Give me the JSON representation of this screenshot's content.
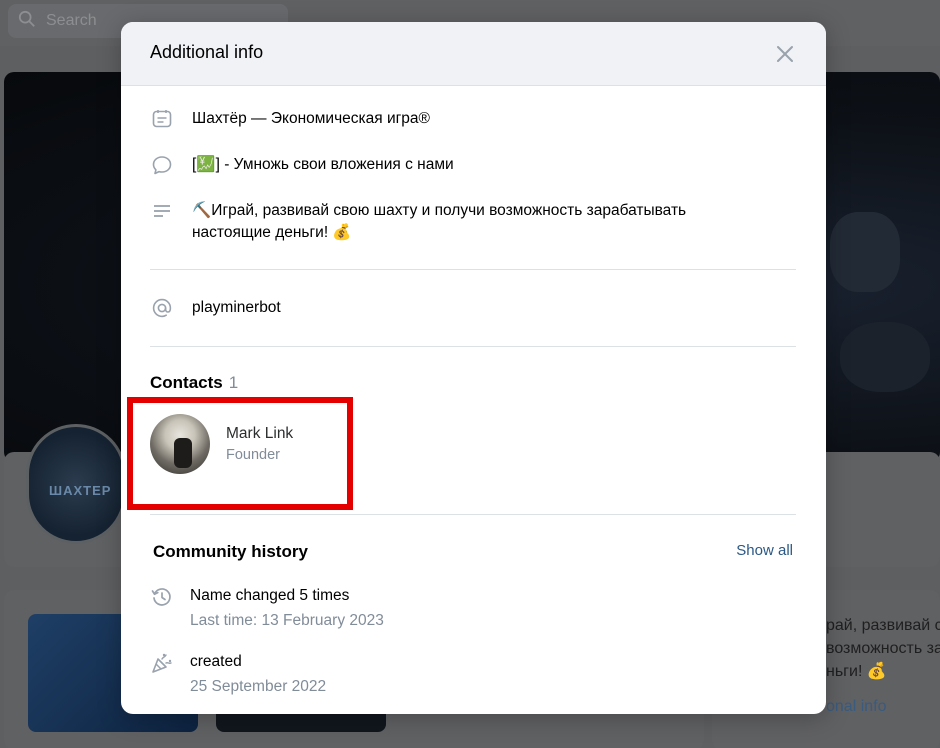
{
  "background": {
    "search_placeholder": "Search",
    "right_text": "рай, развивай с\nвозможность зараба\nньги! 💰",
    "right_link": "onal info",
    "avatar_text": "ШАХТЕР"
  },
  "modal": {
    "title": "Additional info",
    "info": [
      {
        "icon": "note-icon",
        "text": "Шахтёр — Экономическая игра®"
      },
      {
        "icon": "comment-icon",
        "text": "[💹] - Умножь свои вложения с нами"
      },
      {
        "icon": "text-lines-icon",
        "text": "⛏️Играй, развивай свою шахту и получи возможность зарабатывать настоящие деньги! 💰"
      }
    ],
    "username": "playminerbot",
    "contacts": {
      "title": "Contacts",
      "count": "1",
      "items": [
        {
          "name": "Mark Link",
          "role": "Founder"
        }
      ]
    },
    "history": {
      "title": "Community history",
      "show_all": "Show all",
      "items": [
        {
          "icon": "history-icon",
          "main": "Name changed 5 times",
          "sub": "Last time: 13 February 2023"
        },
        {
          "icon": "party-popper-icon",
          "main": "created",
          "sub": "25 September 2022"
        }
      ]
    }
  },
  "colors": {
    "highlight": "#e50000",
    "link": "#2a5885",
    "secondary_text": "#818c99"
  }
}
